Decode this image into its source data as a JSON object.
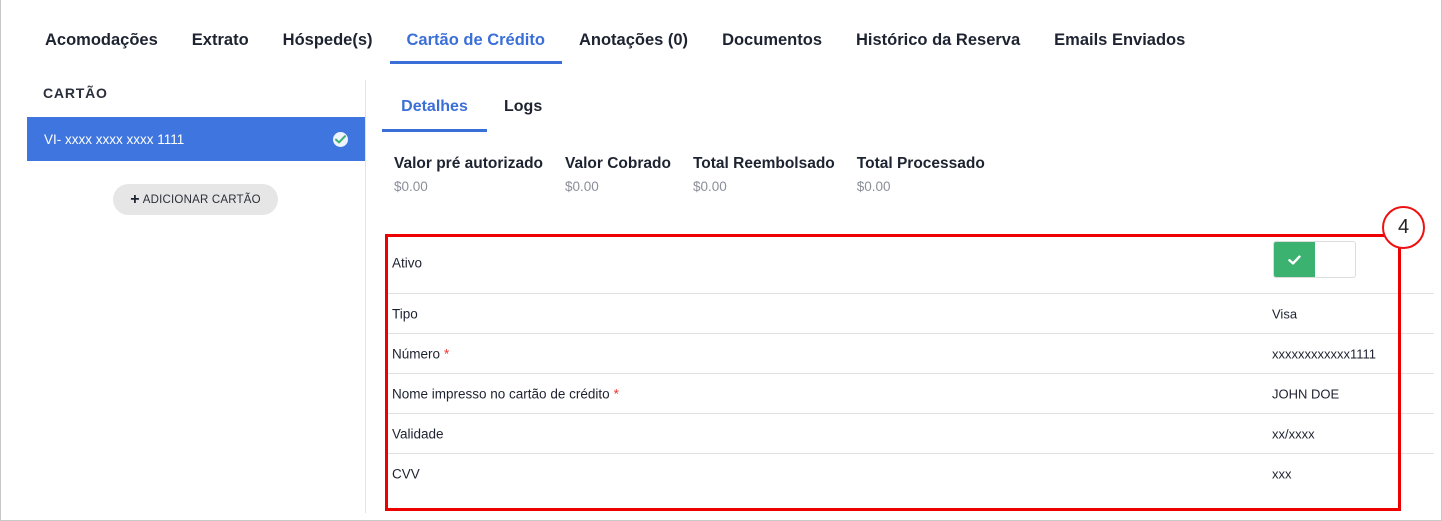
{
  "top_tabs": [
    {
      "label": "Acomodações"
    },
    {
      "label": "Extrato"
    },
    {
      "label": "Hóspede(s)"
    },
    {
      "label": "Cartão de Crédito"
    },
    {
      "label": "Anotações (0)"
    },
    {
      "label": "Documentos"
    },
    {
      "label": "Histórico da Reserva"
    },
    {
      "label": "Emails Enviados"
    }
  ],
  "active_top_tab": "Cartão de Crédito",
  "sidebar": {
    "title": "CARTÃO",
    "card_label": "VI- xxxx xxxx xxxx 1111",
    "card_status_icon": "check-circle-icon",
    "add_button_label": "ADICIONAR CARTÃO"
  },
  "sub_tabs": [
    {
      "label": "Detalhes"
    },
    {
      "label": "Logs"
    }
  ],
  "active_sub_tab": "Detalhes",
  "summary": [
    {
      "label": "Valor pré autorizado",
      "value": "$0.00"
    },
    {
      "label": "Valor Cobrado",
      "value": "$0.00"
    },
    {
      "label": "Total Reembolsado",
      "value": "$0.00"
    },
    {
      "label": "Total Processado",
      "value": "$0.00"
    }
  ],
  "annotation_number": "4",
  "details": {
    "active": {
      "label": "Ativo",
      "enabled": true
    },
    "rows": [
      {
        "label": "Tipo",
        "value": "Visa",
        "required": ""
      },
      {
        "label": "Número",
        "value": "xxxxxxxxxxxx1111",
        "required": "*"
      },
      {
        "label": "Nome impresso no cartão de crédito",
        "value": "JOHN DOE",
        "required": "*"
      },
      {
        "label": "Validade",
        "value": "xx/xxxx",
        "required": ""
      },
      {
        "label": "CVV",
        "value": "xxx",
        "required": ""
      }
    ]
  },
  "colors": {
    "accent": "#3b6fd8",
    "selected_card_bg": "#3f75df",
    "toggle_on": "#3cb271",
    "highlight_box": "#ee0000"
  }
}
